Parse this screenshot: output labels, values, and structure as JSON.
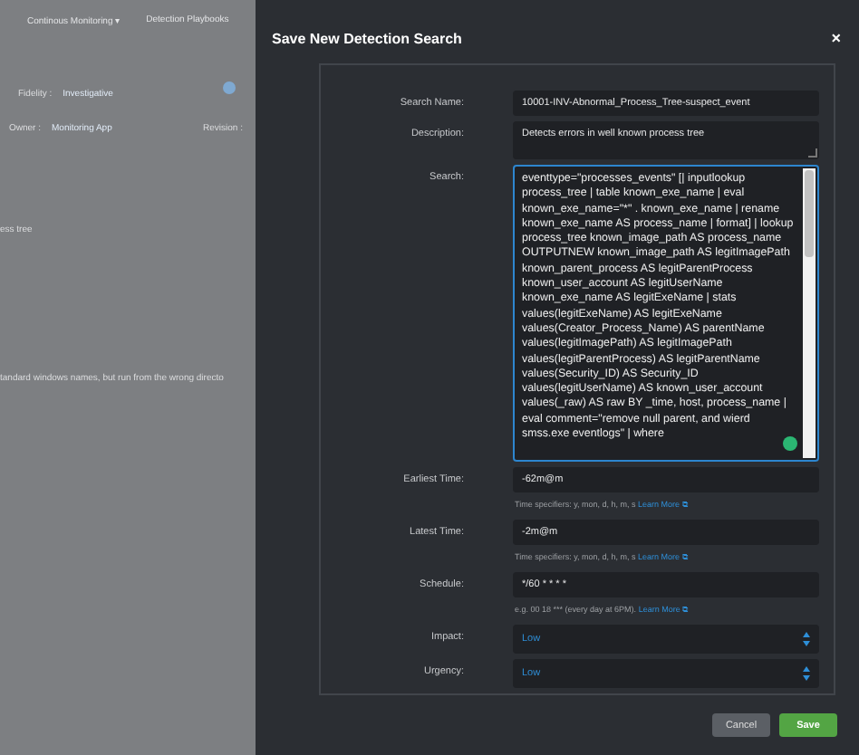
{
  "background": {
    "nav": [
      "Continous Monitoring ▾",
      "Detection Playbooks"
    ],
    "meta": [
      {
        "label": "Fidelity :",
        "value": "Investigative"
      },
      {
        "label": "Owner :",
        "value": "Monitoring App"
      }
    ],
    "revision_label": "Revision :",
    "texts": [
      "ess tree",
      "tandard windows names, but run from the wrong directo"
    ]
  },
  "dialog": {
    "title": "Save New Detection Search",
    "close": "×",
    "fields": [
      {
        "kind": "text",
        "label": "Search Name:",
        "value": "10001-INV-Abnormal_Process_Tree-suspect_event"
      },
      {
        "kind": "textarea",
        "label": "Description:",
        "value": "Detects errors in well known process tree"
      },
      {
        "kind": "code",
        "label": "Search:",
        "value": "eventtype=\"processes_events\" [| inputlookup process_tree | table known_exe_name | eval known_exe_name=\"*\" . known_exe_name | rename known_exe_name AS process_name | format] | lookup process_tree known_image_path AS process_name OUTPUTNEW known_image_path AS legitImagePath known_parent_process AS legitParentProcess known_user_account AS legitUserName known_exe_name AS legitExeName | stats values(legitExeName) AS legitExeName values(Creator_Process_Name) AS parentName values(legitImagePath) AS legitImagePath values(legitParentProcess) AS legitParentName values(Security_ID) AS Security_ID values(legitUserName) AS known_user_account values(_raw) AS raw BY _time, host, process_name | eval comment=\"remove null parent, and wierd smss.exe eventlogs\" | where"
      },
      {
        "kind": "text",
        "label": "Earliest Time:",
        "value": "-62m@m",
        "hint": "Time specifiers: y, mon, d, h, m, s",
        "link": "Learn More ⧉"
      },
      {
        "kind": "text",
        "label": "Latest Time:",
        "value": "-2m@m",
        "hint": "Time specifiers: y, mon, d, h, m, s",
        "link": "Learn More ⧉"
      },
      {
        "kind": "text",
        "label": "Schedule:",
        "value": "*/60 * * * *",
        "hint": "e.g. 00 18 *** (every day at 6PM).",
        "link": "Learn More ⧉"
      },
      {
        "kind": "select",
        "label": "Impact:",
        "value": "Low"
      },
      {
        "kind": "select",
        "label": "Urgency:",
        "value": "Low"
      }
    ],
    "buttons": [
      {
        "label": "Cancel",
        "kind": "secondary"
      },
      {
        "label": "Save",
        "kind": "primary"
      }
    ]
  }
}
